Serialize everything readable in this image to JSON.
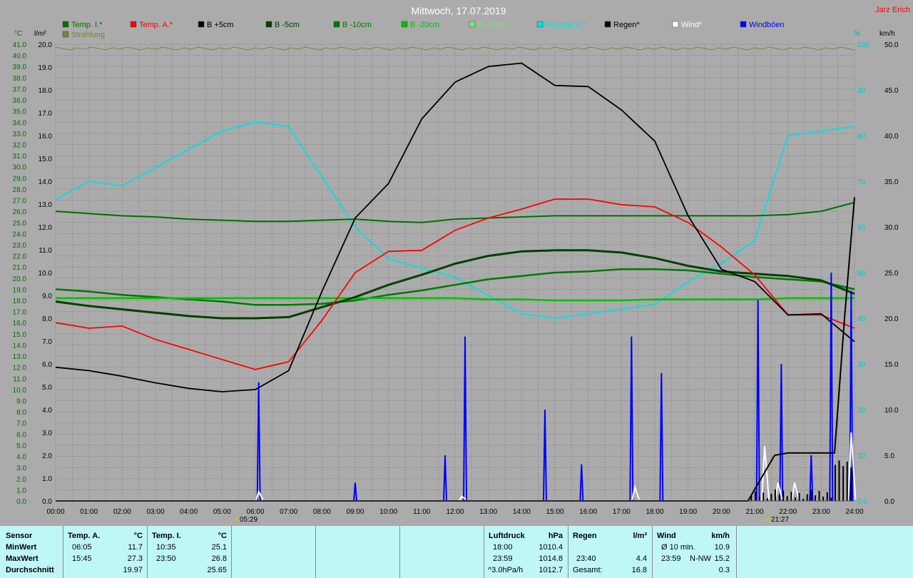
{
  "header": {
    "title": "Mittwoch, 17.07.2019",
    "author": "Jarz Erich"
  },
  "legend": [
    {
      "label": "Temp. I.*",
      "color": "#007000"
    },
    {
      "label": "Temp. A.*",
      "color": "#ff0000"
    },
    {
      "label": "B +5cm",
      "color": "#000000"
    },
    {
      "label": "B -5cm",
      "color": "#004000"
    },
    {
      "label": "B -10cm",
      "color": "#007800"
    },
    {
      "label": "B -20cm",
      "color": "#00c000"
    },
    {
      "label": "B -50cm",
      "color": "#80e080"
    },
    {
      "label": "Feuchte A.*",
      "color": "#00e0e0"
    },
    {
      "label": "Regen*",
      "color": "#000000"
    },
    {
      "label": "Wind*",
      "color": "#ffffff"
    },
    {
      "label": "Windböen",
      "color": "#0000ff"
    },
    {
      "label": "Strahlung",
      "color": "#808040"
    }
  ],
  "axes": {
    "left_temp_unit": "°C",
    "left_rain_unit": "l/m²",
    "right_hum_unit": "%",
    "right_wind_unit": "km/h",
    "temp_ticks": [
      "41.0",
      "40.0",
      "39.0",
      "38.0",
      "37.0",
      "36.0",
      "35.0",
      "34.0",
      "33.0",
      "32.0",
      "31.0",
      "30.0",
      "29.0",
      "28.0",
      "27.0",
      "26.0",
      "25.0",
      "24.0",
      "23.0",
      "22.0",
      "21.0",
      "20.0",
      "19.0",
      "18.0",
      "17.0",
      "16.0",
      "15.0",
      "14.0",
      "13.0",
      "12.0",
      "11.0",
      "10.0",
      "9.0",
      "8.0",
      "7.0",
      "6.0",
      "5.0",
      "4.0",
      "3.0",
      "2.0",
      "1.0",
      "0.0"
    ],
    "rain_ticks": [
      "20.0",
      "19.0",
      "18.0",
      "17.0",
      "16.0",
      "15.0",
      "14.0",
      "13.0",
      "12.0",
      "11.0",
      "10.0",
      "9.0",
      "8.0",
      "7.0",
      "6.0",
      "5.0",
      "4.0",
      "3.0",
      "2.0",
      "1.0",
      "0.0"
    ],
    "hum_ticks": [
      "100",
      "90",
      "80",
      "70",
      "60",
      "50",
      "40",
      "30",
      "20",
      "10",
      "0.0"
    ],
    "wind_ticks": [
      "50.0",
      "45.0",
      "40.0",
      "35.0",
      "30.0",
      "25.0",
      "20.0",
      "15.0",
      "10.0",
      "5.0",
      "0.0"
    ],
    "time_ticks": [
      "00:00",
      "01:00",
      "02:00",
      "03:00",
      "04:00",
      "05:00",
      "06:00",
      "07:00",
      "08:00",
      "09:00",
      "10:00",
      "11:00",
      "12:00",
      "13:00",
      "14:00",
      "15:00",
      "16:00",
      "17:00",
      "18:00",
      "19:00",
      "20:00",
      "21:00",
      "22:00",
      "23:00",
      "24:00"
    ]
  },
  "sun": {
    "sunrise": "05:29",
    "sunset": "21:27"
  },
  "colors": {
    "plot_bg": "#ababab",
    "grid": "#8c8c8c",
    "stats_bg": "#bff7f7",
    "title": "#ffffff",
    "author": "#ff0000"
  },
  "chart_data": {
    "type": "line",
    "title": "Mittwoch, 17.07.2019",
    "x_range": [
      "00:00",
      "24:00"
    ],
    "ylim_temp": [
      0,
      41
    ],
    "ylim_rain": [
      0,
      20
    ],
    "ylim_humidity": [
      0,
      100
    ],
    "ylim_wind": [
      0,
      50
    ],
    "grid": true,
    "legend_position": "top",
    "x": [
      0,
      1,
      2,
      3,
      4,
      5,
      6,
      7,
      8,
      9,
      10,
      11,
      12,
      13,
      14,
      15,
      16,
      17,
      18,
      19,
      20,
      21,
      22,
      23,
      24
    ],
    "series": [
      {
        "name": "Temp. A.*",
        "axis": "temp",
        "color": "#ff0000",
        "values": [
          16.0,
          15.5,
          15.7,
          14.5,
          13.6,
          12.7,
          11.8,
          12.5,
          16.2,
          20.5,
          22.4,
          22.5,
          24.3,
          25.4,
          26.2,
          27.1,
          27.1,
          26.6,
          26.4,
          25.0,
          22.8,
          20.3,
          16.7,
          16.7,
          15.5
        ]
      },
      {
        "name": "Temp. I.*",
        "axis": "temp",
        "color": "#007000",
        "values": [
          26.0,
          25.8,
          25.6,
          25.5,
          25.3,
          25.2,
          25.1,
          25.1,
          25.2,
          25.3,
          25.1,
          25.0,
          25.3,
          25.4,
          25.5,
          25.6,
          25.6,
          25.6,
          25.6,
          25.6,
          25.6,
          25.6,
          25.7,
          26.0,
          26.8
        ]
      },
      {
        "name": "B +5cm",
        "axis": "temp",
        "color": "#000000",
        "values": [
          12.0,
          11.7,
          11.2,
          10.6,
          10.1,
          9.8,
          10.0,
          11.7,
          18.8,
          25.4,
          28.5,
          34.3,
          37.6,
          39.0,
          39.3,
          37.3,
          37.2,
          35.1,
          32.3,
          25.6,
          20.8,
          19.7,
          16.7,
          16.8,
          14.3
        ]
      },
      {
        "name": "B -5cm",
        "axis": "temp",
        "color": "#004000",
        "values": [
          17.9,
          17.5,
          17.2,
          16.9,
          16.6,
          16.4,
          16.4,
          16.5,
          17.4,
          18.3,
          19.4,
          20.3,
          21.3,
          22.0,
          22.4,
          22.5,
          22.5,
          22.3,
          21.8,
          21.1,
          20.6,
          20.4,
          20.2,
          19.8,
          18.6
        ]
      },
      {
        "name": "B -10cm",
        "axis": "temp",
        "color": "#007800",
        "values": [
          19.0,
          18.8,
          18.5,
          18.3,
          18.1,
          17.9,
          17.6,
          17.6,
          17.7,
          18.0,
          18.5,
          18.9,
          19.4,
          19.9,
          20.2,
          20.5,
          20.6,
          20.8,
          20.8,
          20.7,
          20.4,
          20.1,
          19.9,
          19.7,
          19.0
        ]
      },
      {
        "name": "B -20cm",
        "axis": "temp",
        "color": "#00c000",
        "values": [
          18.2,
          18.2,
          18.2,
          18.2,
          18.2,
          18.2,
          18.2,
          18.2,
          18.2,
          18.2,
          18.2,
          18.2,
          18.2,
          18.1,
          18.1,
          18.0,
          18.0,
          18.0,
          18.1,
          18.1,
          18.1,
          18.1,
          18.2,
          18.2,
          18.2
        ]
      },
      {
        "name": "Feuchte A.*",
        "axis": "humidity",
        "color": "#00e0e0",
        "values": [
          66,
          70,
          69,
          73,
          77,
          81,
          83,
          82,
          71,
          60,
          53,
          51,
          49,
          45,
          41,
          40,
          41,
          42,
          43,
          48,
          52,
          57,
          80,
          81,
          82
        ]
      },
      {
        "name": "Windböen",
        "axis": "wind",
        "color": "#0000ff",
        "gusts": [
          [
            6.1,
            13
          ],
          [
            9.0,
            2
          ],
          [
            11.7,
            5
          ],
          [
            12.3,
            18
          ],
          [
            14.7,
            10
          ],
          [
            15.8,
            4
          ],
          [
            17.3,
            18
          ],
          [
            18.2,
            14
          ],
          [
            19.8,
            0
          ],
          [
            21.1,
            22
          ],
          [
            21.8,
            15
          ],
          [
            22.7,
            5
          ],
          [
            23.3,
            25
          ],
          [
            23.9,
            23
          ]
        ]
      },
      {
        "name": "Wind*",
        "axis": "wind",
        "color": "#ffffff",
        "events": [
          [
            6.1,
            1
          ],
          [
            12.2,
            0.5
          ],
          [
            17.4,
            1.5
          ],
          [
            21.3,
            6
          ],
          [
            21.7,
            2
          ],
          [
            22.2,
            2
          ],
          [
            23.9,
            7.5
          ]
        ]
      },
      {
        "name": "Regen*",
        "axis": "rain",
        "color": "#000000",
        "cumulative": [
          [
            0,
            0
          ],
          [
            20.8,
            0
          ],
          [
            21.2,
            1
          ],
          [
            21.6,
            2
          ],
          [
            22.0,
            2.1
          ],
          [
            23.0,
            2.1
          ],
          [
            23.4,
            2.1
          ],
          [
            23.7,
            8
          ],
          [
            24.0,
            13.3
          ]
        ]
      }
    ]
  },
  "stats": {
    "sensor": {
      "header": "Sensor",
      "rows": [
        "MinWert",
        "MaxWert",
        "Durchschnitt"
      ]
    },
    "temp_a": {
      "header": "Temp. A.",
      "unit": "°C",
      "min_time": "06:05",
      "min": "11.7",
      "max_time": "15:45",
      "max": "27.3",
      "avg": "19.97"
    },
    "temp_i": {
      "header": "Temp. I.",
      "unit": "°C",
      "min_time": "10:35",
      "min": "25.1",
      "max_time": "23:50",
      "max": "26.8",
      "avg": "25.65"
    },
    "pressure": {
      "header": "Luftdruck",
      "unit": "hPa",
      "min_time": "18:00",
      "min": "1010.4",
      "max_time": "23:59",
      "max": "1014.8",
      "trend_label": "^3.0hPa/h",
      "trend_value": "1012.7"
    },
    "rain": {
      "header": "Regen",
      "unit": "l/m²",
      "row2_time": "23:40",
      "row2_value": "4.4",
      "total_label": "Gesamt:",
      "total_value": "16.8"
    },
    "wind": {
      "header": "Wind",
      "unit": "km/h",
      "avg_label": "Ø 10 min.",
      "avg_value": "10.9",
      "max_time": "23:59",
      "max_dir": "N-NW",
      "max_value": "15.2",
      "row3_value": "0.3"
    }
  }
}
